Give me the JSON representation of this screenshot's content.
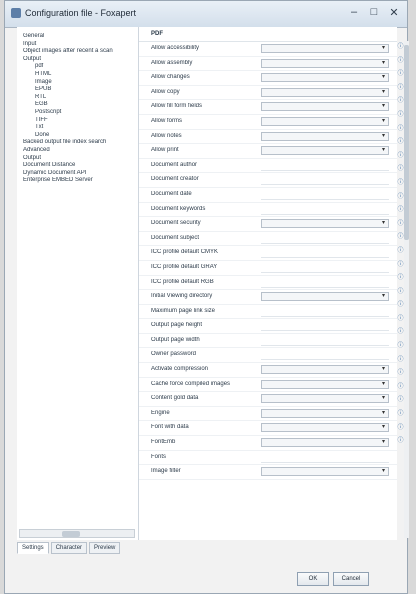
{
  "window": {
    "title": "Configuration file - Foxapert"
  },
  "title_controls": {
    "minimize": "–",
    "maximize": "□",
    "close": "✕"
  },
  "tree": {
    "items": [
      {
        "label": "General",
        "level": 1
      },
      {
        "label": "Input",
        "level": 1
      },
      {
        "label": "Object images after recent a scan",
        "level": 1
      },
      {
        "label": "Output",
        "level": 1
      },
      {
        "label": "pdf",
        "level": 2
      },
      {
        "label": "HTML",
        "level": 2
      },
      {
        "label": "Image",
        "level": 2
      },
      {
        "label": "EPUB",
        "level": 2
      },
      {
        "label": "RTL",
        "level": 2
      },
      {
        "label": "EGB",
        "level": 2
      },
      {
        "label": "Postscript",
        "level": 2
      },
      {
        "label": "TIFF",
        "level": 2
      },
      {
        "label": "Txt",
        "level": 2
      },
      {
        "label": "Done",
        "level": 2
      },
      {
        "label": "Backed output file index search",
        "level": 1
      },
      {
        "label": "Advanced",
        "level": 1
      },
      {
        "label": "Output",
        "level": 1
      },
      {
        "label": "Document Distance",
        "level": 1
      },
      {
        "label": "Dynamic Document API",
        "level": 1
      },
      {
        "label": "Enterprise EMBED Server",
        "level": 1
      }
    ]
  },
  "props": {
    "header": "PDF",
    "rows": [
      {
        "label": "Allow accessibility",
        "kind": "combo"
      },
      {
        "label": "Allow assembly",
        "kind": "combo"
      },
      {
        "label": "Allow changes",
        "kind": "combo"
      },
      {
        "label": "Allow copy",
        "kind": "combo"
      },
      {
        "label": "Allow fill form fields",
        "kind": "combo"
      },
      {
        "label": "Allow forms",
        "kind": "combo"
      },
      {
        "label": "Allow notes",
        "kind": "combo"
      },
      {
        "label": "Allow print",
        "kind": "combo"
      },
      {
        "label": "Document author",
        "kind": "text"
      },
      {
        "label": "Document creator",
        "kind": "text"
      },
      {
        "label": "Document date",
        "kind": "text"
      },
      {
        "label": "Document keywords",
        "kind": "text"
      },
      {
        "label": "Document security",
        "kind": "combo"
      },
      {
        "label": "Document subject",
        "kind": "text"
      },
      {
        "label": "ICC profile default CMYK",
        "kind": "text"
      },
      {
        "label": "ICC profile default GRAY",
        "kind": "text"
      },
      {
        "label": "ICC profile default RGB",
        "kind": "text"
      },
      {
        "label": "Initial Viewing directory",
        "kind": "combo"
      },
      {
        "label": "Maximum page link size",
        "kind": "text"
      },
      {
        "label": "Output page height",
        "kind": "text"
      },
      {
        "label": "Output page width",
        "kind": "text"
      },
      {
        "label": "Owner password",
        "kind": "text"
      },
      {
        "label": "Activate compression",
        "kind": "combo"
      },
      {
        "label": "Cache force compiled images",
        "kind": "combo"
      },
      {
        "label": "Content gold data",
        "kind": "combo"
      },
      {
        "label": "Engine",
        "kind": "combo"
      },
      {
        "label": "Font with data",
        "kind": "combo"
      },
      {
        "label": "FontEmb",
        "kind": "combo"
      },
      {
        "label": "Fonts",
        "kind": "text"
      },
      {
        "label": "Image filter",
        "kind": "combo"
      }
    ]
  },
  "tabs": [
    "Settings",
    "Character",
    "Preview"
  ],
  "buttons": {
    "ok": "OK",
    "cancel": "Cancel"
  }
}
